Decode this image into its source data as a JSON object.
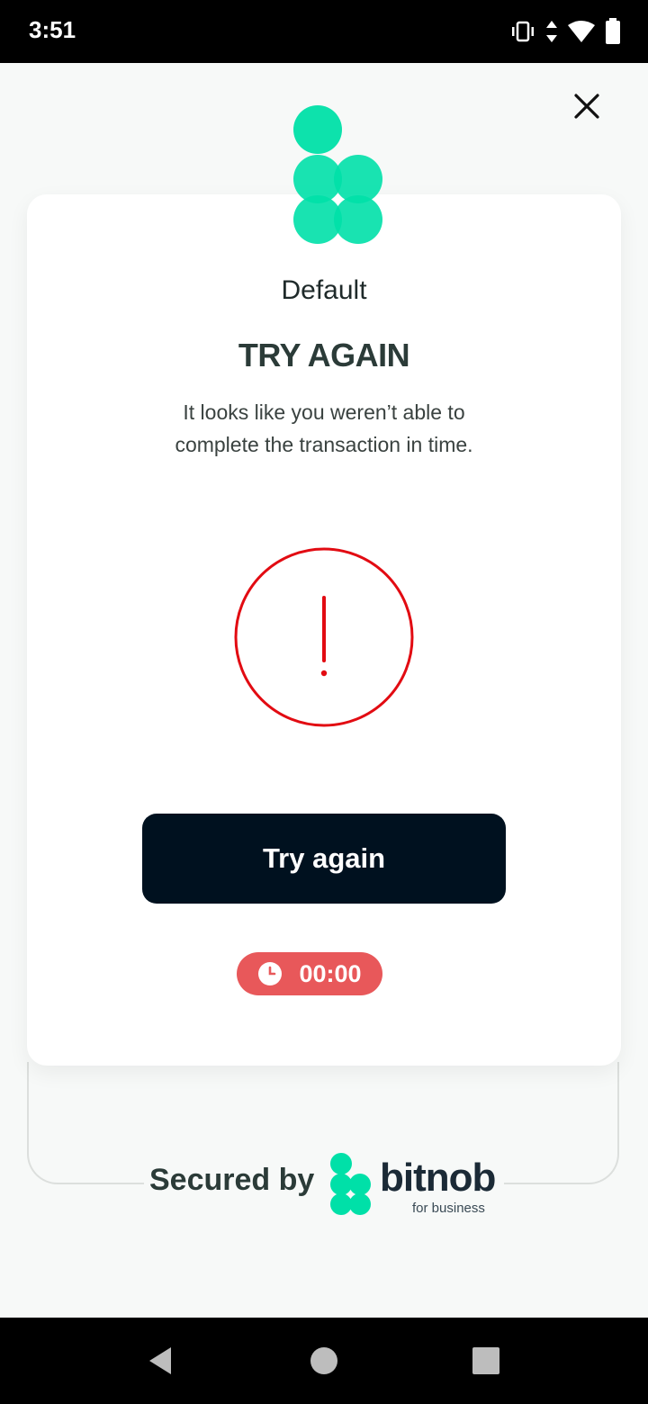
{
  "status_bar": {
    "time": "3:51",
    "icons": [
      "vibrate-icon",
      "data-arrows-icon",
      "wifi-icon",
      "battery-icon"
    ]
  },
  "header": {
    "close_icon": "close-icon"
  },
  "card": {
    "merchant_name": "Default",
    "title": "TRY AGAIN",
    "message": "It looks like you weren’t able to complete the transaction in time.",
    "alert_icon": "exclamation-circle-icon",
    "alert_color": "#e20b12",
    "try_again_label": "Try again",
    "timer": "00:00"
  },
  "footer": {
    "secured_label": "Secured by",
    "brand_name": "bitnob",
    "brand_tagline": "for business"
  },
  "nav_bar": {
    "buttons": [
      "back-icon",
      "home-icon",
      "recents-icon"
    ]
  },
  "colors": {
    "accent_green": "#00e0a8",
    "button_dark": "#00111f",
    "timer_red": "#e8585a",
    "title_text": "#2b3b38"
  }
}
